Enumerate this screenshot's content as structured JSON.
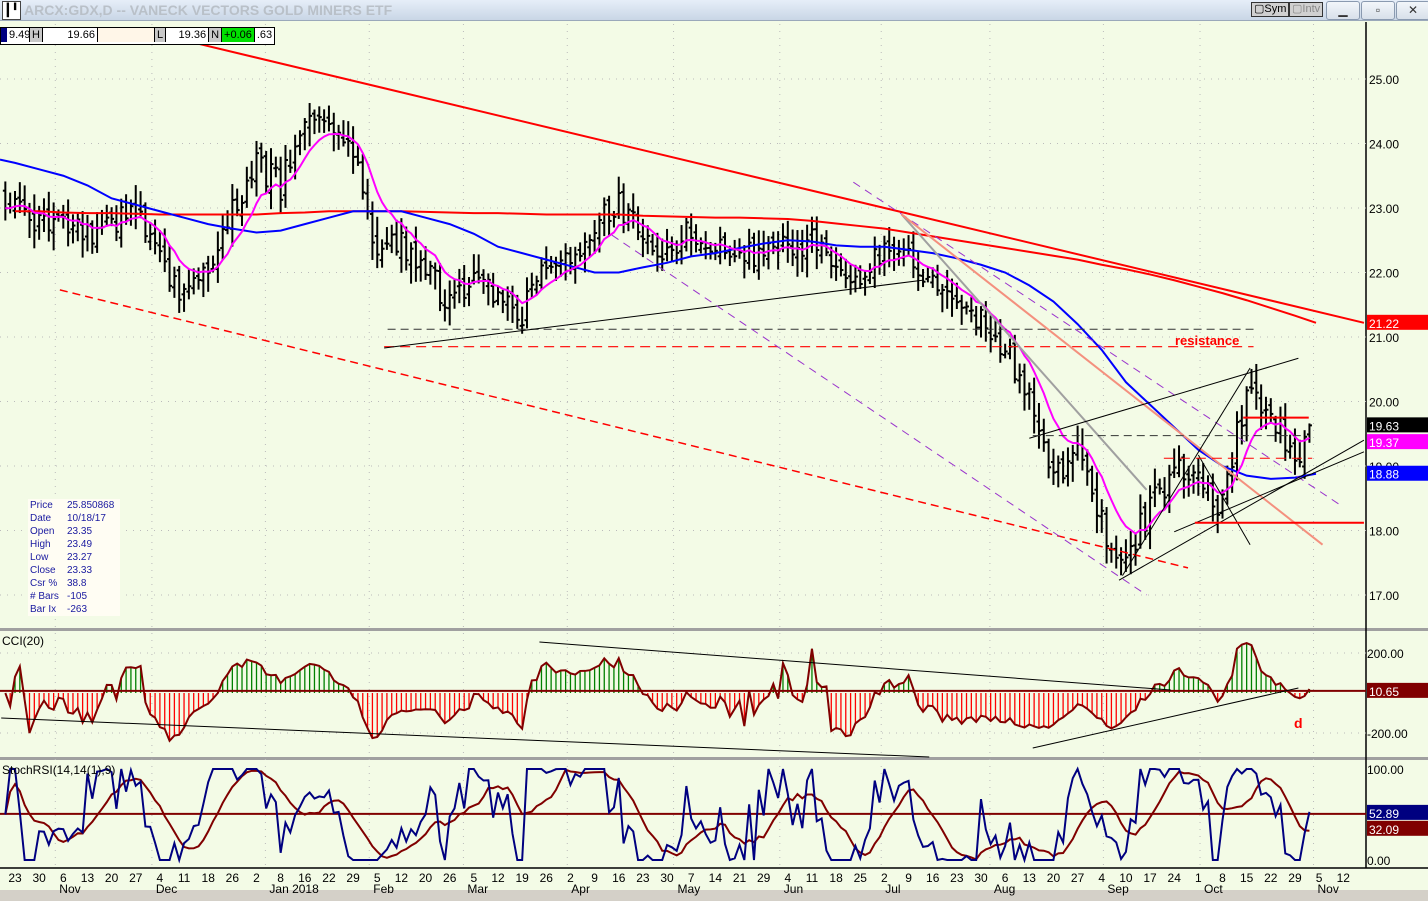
{
  "window": {
    "title": "ARCX:GDX,D -- VANECK VECTORS GOLD MINERS ETF",
    "app_icon": "chart-bars-icon",
    "buttons": {
      "sym": "Sym",
      "intv": "Intv",
      "minimize": "minimize-icon",
      "maximize": "maximize-icon",
      "close": "close-icon"
    }
  },
  "infobar": {
    "open_partial": "9.49",
    "high_label": "H",
    "high": "19.66",
    "low_label": "L",
    "low": "19.36",
    "net_label": "N",
    "net": "+0.06",
    "close_partial": ".63"
  },
  "cursor_info": [
    {
      "k": "Price",
      "v": "25.850868"
    },
    {
      "k": "Date",
      "v": "10/18/17"
    },
    {
      "k": "Open",
      "v": "23.35"
    },
    {
      "k": "High",
      "v": "23.49"
    },
    {
      "k": "Low",
      "v": "23.27"
    },
    {
      "k": "Close",
      "v": "23.33"
    },
    {
      "k": "Csr %",
      "v": "38.8"
    },
    {
      "k": "# Bars",
      "v": "-105"
    },
    {
      "k": "Bar Ix",
      "v": "-263"
    }
  ],
  "colors": {
    "background": "#F3FBE6",
    "bars": "#000000",
    "ma_short": "#FF00FF",
    "ma_mid": "#0000FF",
    "ma_long": "#FF0000",
    "cci_pos": "#008000",
    "cci_neg": "#FF0000",
    "stoch_k": "#000080",
    "stoch_d": "#800000"
  },
  "chart_data": [
    {
      "type": "ohlc",
      "panel": "price",
      "x_ticks": [
        "23",
        "30",
        "6",
        "13",
        "20",
        "27",
        "4",
        "11",
        "18",
        "26",
        "2",
        "8",
        "16",
        "22",
        "29",
        "5",
        "12",
        "20",
        "26",
        "5",
        "12",
        "19",
        "26",
        "2",
        "9",
        "16",
        "23",
        "30",
        "7",
        "14",
        "21",
        "29",
        "4",
        "11",
        "18",
        "25",
        "2",
        "9",
        "16",
        "23",
        "30",
        "6",
        "13",
        "20",
        "27",
        "4",
        "10",
        "17",
        "24",
        "1",
        "8",
        "15",
        "22",
        "29",
        "5",
        "12"
      ],
      "x_months": [
        {
          "label": "Nov",
          "week": 2
        },
        {
          "label": "Dec",
          "week": 6
        },
        {
          "label": "Jan 2018",
          "week": 10.7
        },
        {
          "label": "Feb",
          "week": 15
        },
        {
          "label": "Mar",
          "week": 18.9
        },
        {
          "label": "Apr",
          "week": 23.2
        },
        {
          "label": "May",
          "week": 27.6
        },
        {
          "label": "Jun",
          "week": 32
        },
        {
          "label": "Jul",
          "week": 36.2
        },
        {
          "label": "Aug",
          "week": 40.7
        },
        {
          "label": "Sep",
          "week": 45.4
        },
        {
          "label": "Oct",
          "week": 49.4
        },
        {
          "label": "Nov",
          "week": 54.1
        }
      ],
      "y_ticks": [
        "25.00",
        "24.00",
        "23.00",
        "22.00",
        "21.00",
        "20.00",
        "19.00",
        "18.00",
        "17.00"
      ],
      "ylim": [
        16.6,
        25.8
      ],
      "weeks": [
        "2017-10-23",
        "2017-10-30",
        "2017-11-06",
        "2017-11-13",
        "2017-11-20",
        "2017-11-27",
        "2017-12-04",
        "2017-12-11",
        "2017-12-18",
        "2017-12-25",
        "2018-01-01",
        "2018-01-08",
        "2018-01-15",
        "2018-01-22",
        "2018-01-29",
        "2018-02-05",
        "2018-02-12",
        "2018-02-19",
        "2018-02-26",
        "2018-03-05",
        "2018-03-12",
        "2018-03-19",
        "2018-03-26",
        "2018-04-02",
        "2018-04-09",
        "2018-04-16",
        "2018-04-23",
        "2018-04-30",
        "2018-05-07",
        "2018-05-14",
        "2018-05-21",
        "2018-05-28",
        "2018-06-04",
        "2018-06-11",
        "2018-06-18",
        "2018-06-25",
        "2018-07-02",
        "2018-07-09",
        "2018-07-16",
        "2018-07-23",
        "2018-07-30",
        "2018-08-06",
        "2018-08-13",
        "2018-08-20",
        "2018-08-27",
        "2018-09-03",
        "2018-09-10",
        "2018-09-17",
        "2018-09-24",
        "2018-10-01",
        "2018-10-08",
        "2018-10-15",
        "2018-10-22",
        "2018-10-29",
        "2018-11-05"
      ],
      "close": [
        23.0,
        22.7,
        22.75,
        22.6,
        22.75,
        22.95,
        22.2,
        21.6,
        22.15,
        23.0,
        23.65,
        23.35,
        24.3,
        24.5,
        23.8,
        22.3,
        22.5,
        22.05,
        21.5,
        21.95,
        21.65,
        21.4,
        22.2,
        22.1,
        22.7,
        23.1,
        22.5,
        22.35,
        22.65,
        22.4,
        22.2,
        22.3,
        22.4,
        22.5,
        22.2,
        21.95,
        22.4,
        22.3,
        21.85,
        21.55,
        21.2,
        20.9,
        20.0,
        18.8,
        19.2,
        18.1,
        17.5,
        18.4,
        18.95,
        18.7,
        18.4,
        20.2,
        19.9,
        19.1,
        19.63
      ],
      "ma50": [
        23.7,
        23.6,
        23.5,
        23.35,
        23.15,
        23.05,
        22.95,
        22.85,
        22.75,
        22.68,
        22.62,
        22.65,
        22.75,
        22.85,
        22.95,
        22.95,
        22.95,
        22.85,
        22.75,
        22.6,
        22.4,
        22.3,
        22.2,
        22.1,
        22.0,
        22.0,
        22.08,
        22.15,
        22.25,
        22.3,
        22.38,
        22.45,
        22.5,
        22.48,
        22.42,
        22.4,
        22.4,
        22.35,
        22.3,
        22.22,
        22.12,
        22.0,
        21.8,
        21.55,
        21.2,
        20.8,
        20.3,
        19.95,
        19.6,
        19.25,
        19.0,
        18.85,
        18.8,
        18.82,
        18.88
      ],
      "ma200": [
        22.95,
        22.95,
        22.93,
        22.92,
        22.92,
        22.91,
        22.9,
        22.9,
        22.9,
        22.9,
        22.9,
        22.92,
        22.93,
        22.95,
        22.95,
        22.95,
        22.95,
        22.94,
        22.93,
        22.92,
        22.92,
        22.91,
        22.9,
        22.9,
        22.9,
        22.9,
        22.88,
        22.87,
        22.86,
        22.85,
        22.85,
        22.84,
        22.83,
        22.8,
        22.76,
        22.72,
        22.68,
        22.62,
        22.56,
        22.5,
        22.44,
        22.38,
        22.32,
        22.26,
        22.2,
        22.12,
        22.05,
        21.97,
        21.88,
        21.78,
        21.68,
        21.57,
        21.45,
        21.33,
        21.22
      ],
      "last_bar": {
        "high": 19.66,
        "low": 19.36,
        "close": 19.63
      },
      "price_labels": {
        "ma200": "21.22",
        "last": "19.63",
        "ma_short": "19.37",
        "ma50": "18.88"
      },
      "annotation": "resistance",
      "trendlines": [
        {
          "kind": "main-downtrend",
          "color": "#FF0000",
          "width": 2,
          "dash": "",
          "p1": [
            "2017-12-11",
            25.6
          ],
          "p2": [
            "2018-11-18",
            21.22
          ]
        },
        {
          "kind": "lower-channel",
          "color": "#FF0000",
          "width": 1.5,
          "dash": "8 5",
          "p1": [
            "2017-11-05",
            21.73
          ],
          "p2": [
            "2018-09-28",
            17.42
          ]
        },
        {
          "kind": "resistance-level",
          "color": "#FF0000",
          "width": 1.2,
          "dash": "10 6",
          "p1": [
            "2018-02-07",
            20.85
          ],
          "p2": [
            "2018-10-17",
            20.85
          ]
        },
        {
          "kind": "level",
          "color": "#333333",
          "width": 1,
          "dash": "8 5",
          "p1": [
            "2018-02-08",
            21.12
          ],
          "p2": [
            "2018-10-17",
            21.12
          ]
        },
        {
          "kind": "support",
          "color": "#000000",
          "width": 1,
          "dash": "",
          "p1": [
            "2018-02-07",
            20.83
          ],
          "p2": [
            "2018-07-13",
            21.88
          ]
        },
        {
          "kind": "channel",
          "color": "#9932CC",
          "width": 1,
          "dash": "8 6",
          "p1": [
            "2018-04-14",
            22.58
          ],
          "p2": [
            "2018-09-16",
            17.0
          ]
        },
        {
          "kind": "channel",
          "color": "#9932CC",
          "width": 1,
          "dash": "8 6",
          "p1": [
            "2018-06-23",
            23.4
          ],
          "p2": [
            "2018-11-11",
            18.4
          ]
        },
        {
          "kind": "downtrend",
          "color": "#A0A0A0",
          "width": 2,
          "dash": "",
          "p1": [
            "2018-07-07",
            22.9
          ],
          "p2": [
            "2018-09-16",
            18.63
          ]
        },
        {
          "kind": "downtrend",
          "color": "#F4907E",
          "width": 2,
          "dash": "",
          "p1": [
            "2018-07-07",
            22.9
          ],
          "p2": [
            "2018-11-06",
            17.78
          ]
        },
        {
          "kind": "channel",
          "color": "#000000",
          "width": 1,
          "dash": "",
          "p1": [
            "2018-08-13",
            19.43
          ],
          "p2": [
            "2018-10-30",
            20.67
          ]
        },
        {
          "kind": "channel",
          "color": "#000000",
          "width": 1,
          "dash": "",
          "p1": [
            "2018-09-08",
            17.23
          ],
          "p2": [
            "2018-11-18",
            19.4
          ]
        },
        {
          "kind": "channel",
          "color": "#000000",
          "width": 1,
          "dash": "",
          "p1": [
            "2018-09-24",
            17.98
          ],
          "p2": [
            "2018-11-18",
            19.22
          ]
        },
        {
          "kind": "fan",
          "color": "#000000",
          "width": 1,
          "dash": "",
          "p1": [
            "2018-09-09",
            17.3
          ],
          "p2": [
            "2018-10-16",
            20.52
          ]
        },
        {
          "kind": "fan",
          "color": "#000000",
          "width": 1,
          "dash": "",
          "p1": [
            "2018-10-01",
            19.17
          ],
          "p2": [
            "2018-10-16",
            17.78
          ]
        },
        {
          "kind": "level",
          "color": "#333333",
          "width": 1,
          "dash": "8 5",
          "p1": [
            "2018-08-14",
            19.47
          ],
          "p2": [
            "2018-11-01",
            19.47
          ]
        },
        {
          "kind": "level",
          "color": "#FF0000",
          "width": 2,
          "dash": "",
          "p1": [
            "2018-10-14",
            19.75
          ],
          "p2": [
            "2018-11-02",
            19.75
          ]
        },
        {
          "kind": "level",
          "color": "#FF0000",
          "width": 1,
          "dash": "10 6",
          "p1": [
            "2018-09-21",
            19.12
          ],
          "p2": [
            "2018-11-03",
            19.12
          ]
        },
        {
          "kind": "level",
          "color": "#FF0000",
          "width": 2,
          "dash": "",
          "p1": [
            "2018-09-30",
            18.12
          ],
          "p2": [
            "2018-11-18",
            18.12
          ]
        }
      ]
    },
    {
      "type": "area",
      "panel": "cci",
      "title": "CCI(20)",
      "y_ticks": [
        "200.00",
        "-200.00"
      ],
      "last_value": "10.65",
      "annotation": "d",
      "trendlines": [
        {
          "p1": [
            "2017-10-19",
            -125
          ],
          "p2": [
            "2018-07-15",
            -320
          ]
        },
        {
          "p1": [
            "2018-03-24",
            255
          ],
          "p2": [
            "2018-09-23",
            15
          ]
        },
        {
          "p1": [
            "2018-08-14",
            -275
          ],
          "p2": [
            "2018-10-30",
            25
          ]
        }
      ]
    },
    {
      "type": "line",
      "panel": "stochrsi",
      "title": "StochRSI(14,14(1),9)",
      "y_ticks": [
        "100.00",
        "0.00"
      ],
      "last_k": "52.89",
      "last_d": "32.09"
    }
  ]
}
